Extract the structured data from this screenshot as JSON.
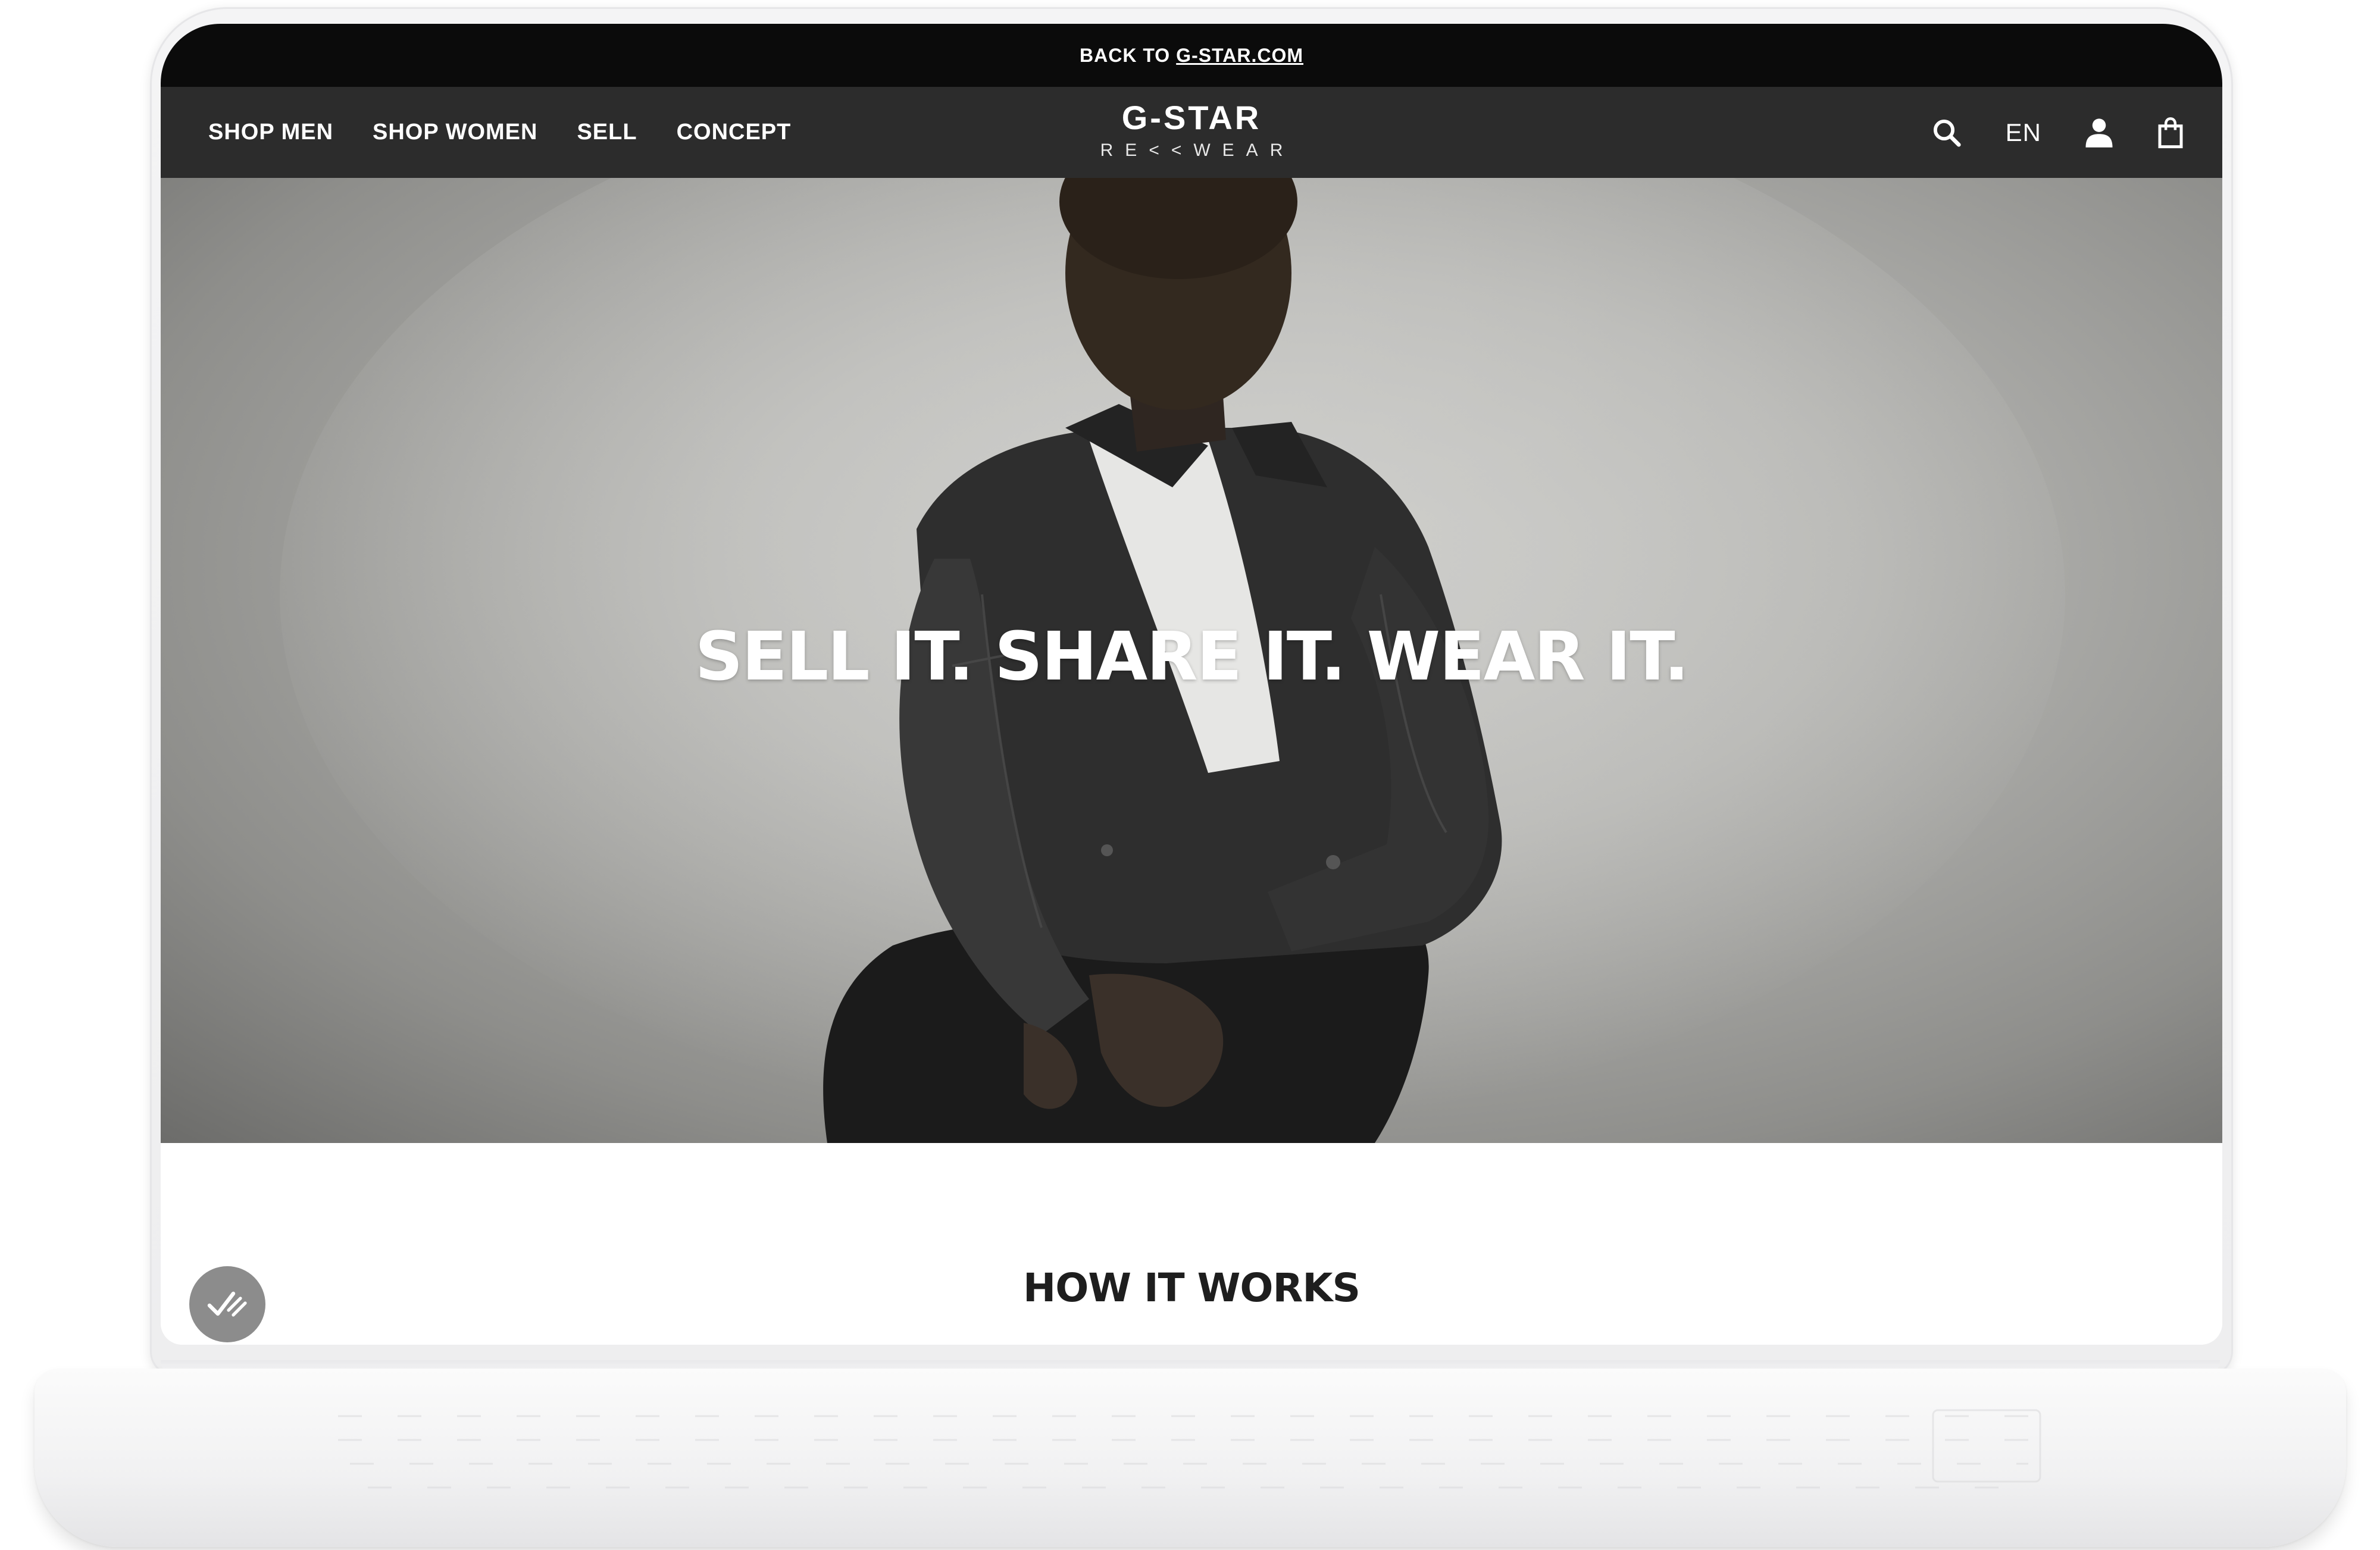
{
  "topbar": {
    "prefix": "BACK TO",
    "link": "G-STAR.COM"
  },
  "nav": {
    "items": [
      "SHOP MEN",
      "SHOP WOMEN",
      "SELL",
      "CONCEPT"
    ],
    "language": "EN",
    "icons": [
      "search-icon",
      "user-icon",
      "shopping-bag-icon"
    ]
  },
  "logo": {
    "main": "G-STAR",
    "sub": "RE<<WEAR"
  },
  "hero": {
    "headline": "SELL IT. SHARE IT. WEAR IT."
  },
  "section": {
    "title": "HOW IT WORKS"
  },
  "badge": {
    "icon": "checkmark-badge-icon"
  },
  "colors": {
    "topbar_bg": "#0b0b0b",
    "navbar_bg": "#2c2c2c",
    "hero_bg": "#b4b4b1",
    "badge_bg": "#8c8c8c"
  }
}
